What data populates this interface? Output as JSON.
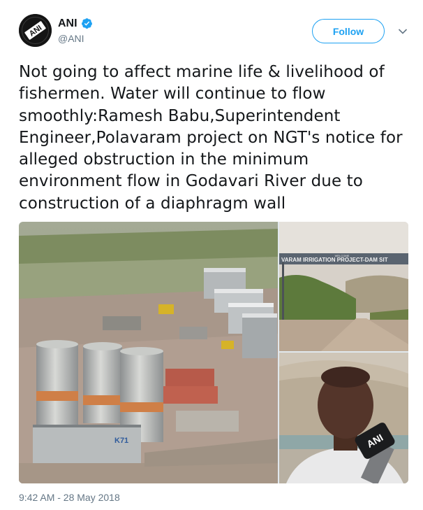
{
  "account": {
    "display_name": "ANI",
    "handle": "@ANI",
    "avatar_text": "ANI"
  },
  "follow_label": "Follow",
  "tweet_text": "Not going to affect marine life & livelihood of fishermen. Water will continue to flow smoothly:Ramesh Babu,Superintendent Engineer,Polavaram project on NGT's notice for alleged obstruction in the minimum environment flow in Godavari River due to construction of a diaphragm wall",
  "media": {
    "photo_main": {
      "silo_sign": "K71"
    },
    "photo_gate": {
      "arch_text": "VARAM IRRIGATION PROJECT-DAM SIT",
      "welcome_text": "WELCOME"
    },
    "photo_person": {
      "mic_label": "ANI"
    }
  },
  "timestamp": "9:42 AM - 28 May 2018",
  "colors": {
    "accent": "#1da1f2",
    "secondary_text": "#657786",
    "primary_text": "#14171a"
  },
  "icons": {
    "verified": "verified-badge-icon",
    "menu": "chevron-down-icon"
  }
}
